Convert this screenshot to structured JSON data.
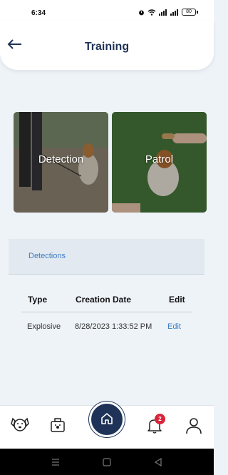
{
  "status_bar": {
    "time": "6:34",
    "battery": "80"
  },
  "header": {
    "title": "Training",
    "back_icon": "arrow-left-icon"
  },
  "cards": [
    {
      "label": "Detection"
    },
    {
      "label": "Patrol"
    }
  ],
  "section_tab": {
    "label": "Detections"
  },
  "table": {
    "headers": {
      "type": "Type",
      "date": "Creation Date",
      "edit": "Edit"
    },
    "rows": [
      {
        "type": "Explosive",
        "date": "8/28/2023 1:33:52 PM",
        "edit": "Edit"
      }
    ]
  },
  "bottom_nav": {
    "items": [
      "dog-icon",
      "kit-icon",
      "home-icon",
      "bell-icon",
      "user-icon"
    ],
    "notification_count": "2"
  },
  "colors": {
    "primary": "#1e3357",
    "link": "#3d7cc0",
    "badge": "#d9253a",
    "background": "#eef3f8"
  }
}
